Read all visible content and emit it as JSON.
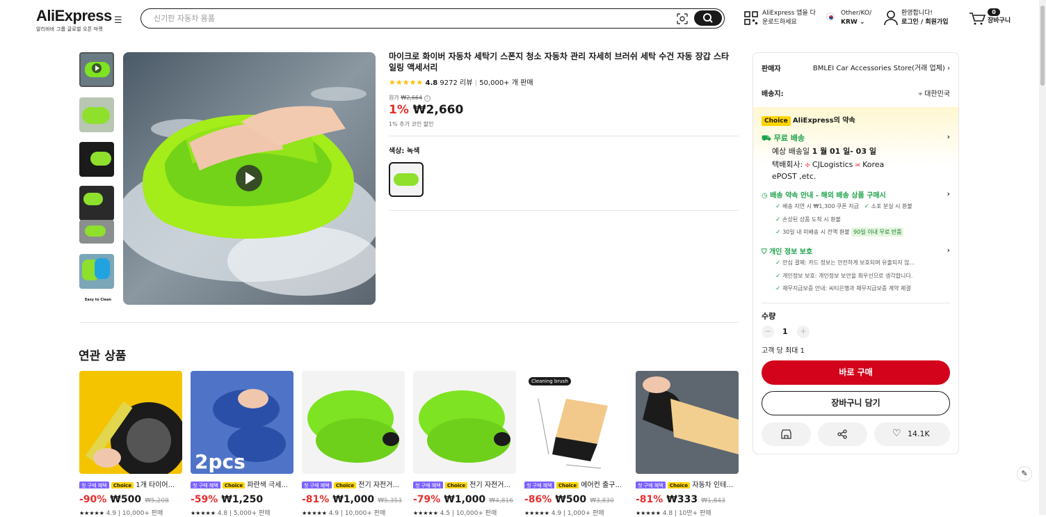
{
  "header": {
    "logo": "AliExpress",
    "logo_tagline": "알리바바 그룹 글로벌 오픈 마켓",
    "search_placeholder": "신기한 자동차 용품",
    "app_download_l1": "AliExpress 앱을 다",
    "app_download_l2": "운로드하세요",
    "region_l1": "Other/KO/",
    "region_l2": "KRW",
    "account_l1": "환영합니다!",
    "account_l2": "로그인 / 회원가입",
    "cart_count": "0",
    "cart_label": "장바구니"
  },
  "thumbnails": [
    "video-thumb",
    "glove-top",
    "glove-wheel",
    "glove-hand",
    "glove-tire",
    "glove-blue",
    "easy-to-clean"
  ],
  "last_thumb_text": "Easy to Clean",
  "product": {
    "title": "마이크로 화이버 자동차 세탁기 스폰지 청소 자동차 관리 자세히 브러쉬 세탁 수건 자동 장갑 스타일링 액세서리",
    "rating": "4.8",
    "reviews": "9272 리뷰",
    "sold": "50,000+ 개 판매",
    "orig_label": "원가",
    "orig_price": "₩2,664",
    "discount": "1%",
    "price": "₩2,660",
    "coin_note": "1% 추가 코인 할인",
    "color_label": "색상: 녹색"
  },
  "panel": {
    "seller_label": "판매자",
    "seller_name": "BMLEI Car Accessories Store(거래 업체)",
    "ship_to_label": "배송지:",
    "ship_to": "대한민국",
    "choice_badge": "Choice",
    "promise_title": "AliExpress의 약속",
    "free_ship": "무료 배송",
    "est_prefix": "예상 배송일 ",
    "est_date": "1 월 01 일- 03 일",
    "carrier_prefix": "택배회사:",
    "carrier_1": "CJLogistics",
    "carrier_2": "Korea",
    "carrier_3": "ePOST ,etc.",
    "promise_section": "배송 약속 안내 - 해외 배송 상품 구매시",
    "promise_1": "배송 지연 시 ₩1,300 쿠폰 지급",
    "promise_2": "소포 분실 시 환불",
    "promise_3": "손상된 상품 도착 시 환불",
    "promise_4": "30일 내 미배송 시 전액 환불",
    "promise_badge": "90일 이내 무료 반품",
    "privacy_title": "개인 정보 보호",
    "privacy_1": "안심 결제: 카드 정보는 안전하게 보호되며 유출되지 않...",
    "privacy_2": "개인정보 보호: 개인정보 보안을 최우선으로 생각합니다.",
    "privacy_3": "채무지급보증 안내: 씨티은행과 채무지급보증 계약 체결",
    "qty_label": "수량",
    "qty_value": "1",
    "qty_max": "고객 당 최대 1",
    "buy_now": "바로 구매",
    "add_cart": "장바구니 담기",
    "wish_count": "14.1K"
  },
  "related": {
    "title": "연관 상품",
    "tag_first": "첫 구매 혜택",
    "tag_choice": "Choice",
    "items": [
      {
        "title": "1개 타이어...",
        "discount": "-90%",
        "price": "₩500",
        "orig": "₩5,208",
        "rating": "4.9",
        "sold": "10,000+ 판매"
      },
      {
        "title": "파란색 극세...",
        "discount": "-59%",
        "price": "₩1,250",
        "orig": "",
        "rating": "4.8",
        "sold": "5,000+ 판매"
      },
      {
        "title": "전기 자전거...",
        "discount": "-81%",
        "price": "₩1,000",
        "orig": "₩5,353",
        "rating": "4.9",
        "sold": "10,000+ 판매"
      },
      {
        "title": "전기 자전거...",
        "discount": "-79%",
        "price": "₩1,000",
        "orig": "₩4,816",
        "rating": "4.5",
        "sold": "10,000+ 판매"
      },
      {
        "title": "에어컨 출구...",
        "discount": "-86%",
        "price": "₩500",
        "orig": "₩3,830",
        "rating": "4.9",
        "sold": "1,000+ 판매"
      },
      {
        "title": "자동차 인테...",
        "discount": "-81%",
        "price": "₩333",
        "orig": "₩1,843",
        "rating": "4.8",
        "sold": "10만+ 판매"
      }
    ],
    "cleaning_label": "Cleaning brush"
  },
  "colors": {
    "accent_red": "#e62e2e",
    "buy_red": "#d3031c",
    "green": "#1fa24a",
    "choice_yellow": "#ffd400"
  }
}
